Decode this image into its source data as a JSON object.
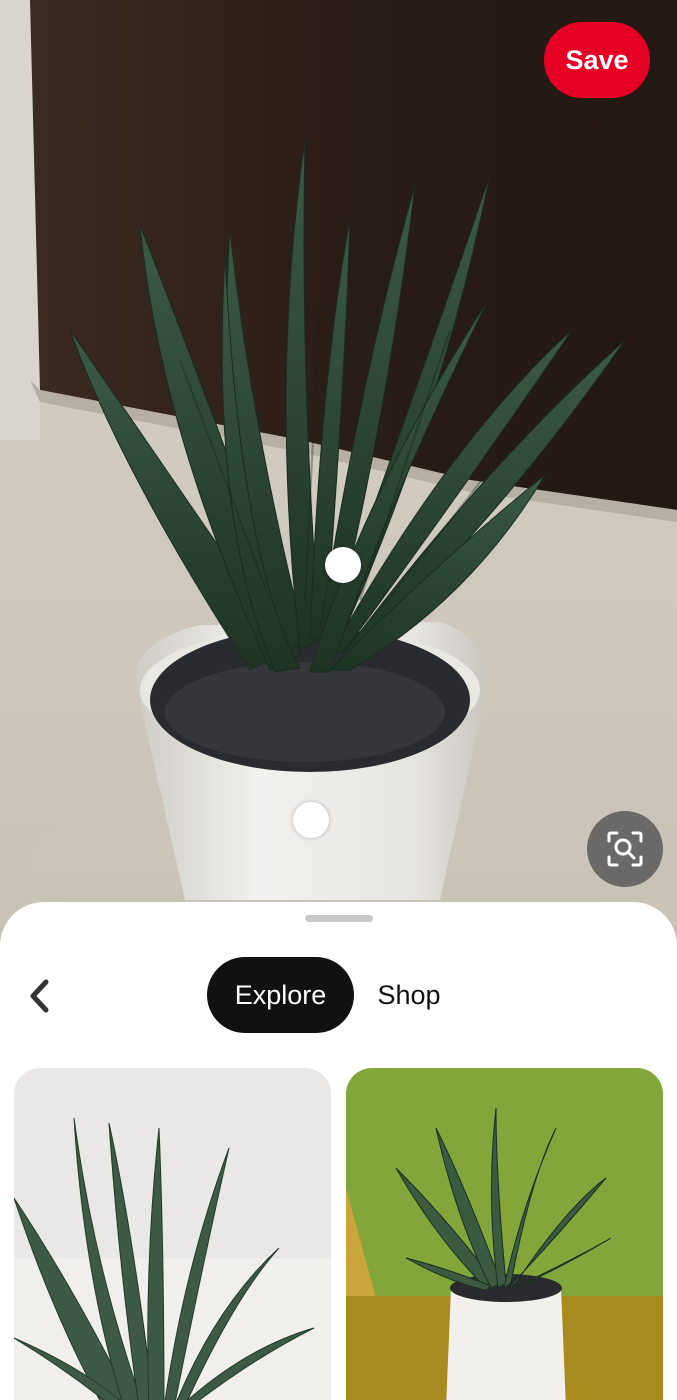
{
  "pin": {
    "save_label": "Save",
    "image_icon": "plant-photo",
    "visual_search_icon": "lens-search-icon"
  },
  "sheet": {
    "back_icon": "chevron-left-icon",
    "tabs": [
      {
        "label": "Explore",
        "selected": true
      },
      {
        "label": "Shop",
        "selected": false
      }
    ],
    "results": [
      {
        "icon": "succulent-photo"
      },
      {
        "icon": "potted-succulent-photo"
      }
    ]
  },
  "colors": {
    "save": "#e60023",
    "tab_active_bg": "#111111",
    "tab_active_text": "#ffffff"
  }
}
